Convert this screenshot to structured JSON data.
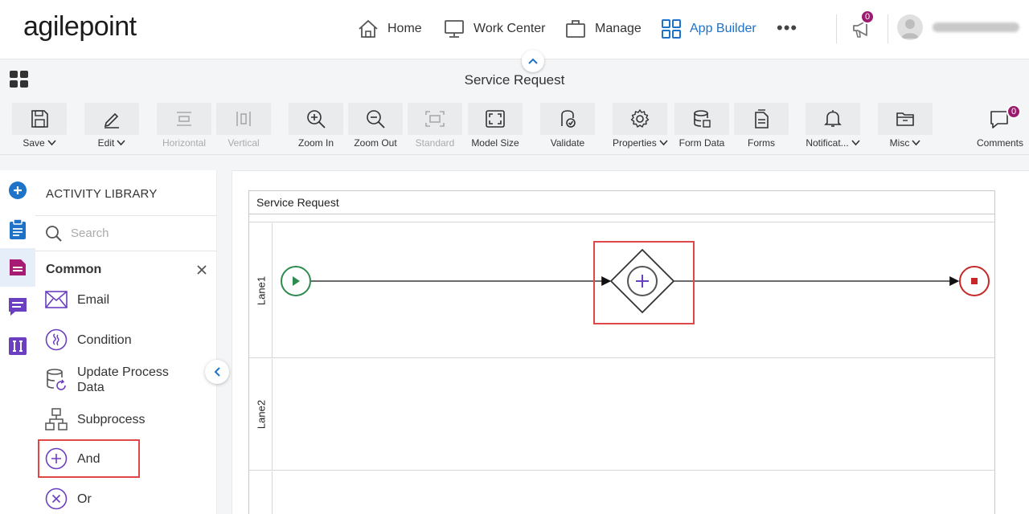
{
  "brand": {
    "logo_text": "agilepoint"
  },
  "nav": {
    "items": [
      {
        "label": "Home",
        "icon": "home-icon"
      },
      {
        "label": "Work Center",
        "icon": "monitor-icon"
      },
      {
        "label": "Manage",
        "icon": "briefcase-icon"
      },
      {
        "label": "App Builder",
        "icon": "grid-icon",
        "active": true
      }
    ],
    "notifications_count": "0"
  },
  "page": {
    "title": "Service Request"
  },
  "toolbar": {
    "save": "Save",
    "edit": "Edit",
    "horizontal": "Horizontal",
    "vertical": "Vertical",
    "zoom_in": "Zoom In",
    "zoom_out": "Zoom Out",
    "standard": "Standard",
    "model_size": "Model Size",
    "validate": "Validate",
    "properties": "Properties",
    "form_data": "Form Data",
    "forms": "Forms",
    "notifications": "Notificat...",
    "misc": "Misc",
    "comments": "Comments",
    "comments_count": "0"
  },
  "library": {
    "title": "ACTIVITY LIBRARY",
    "search_placeholder": "Search",
    "group": "Common",
    "items": {
      "email": "Email",
      "condition": "Condition",
      "update_process_data": "Update Process Data",
      "subprocess": "Subprocess",
      "and": "And",
      "or": "Or"
    }
  },
  "canvas": {
    "pool_title": "Service Request",
    "lanes": [
      "Lane1",
      "Lane2"
    ]
  },
  "colors": {
    "accent_blue": "#1e73c8",
    "badge": "#9b1b6e",
    "start_event": "#2e8b4e",
    "end_event": "#c62828",
    "highlight": "#e04848",
    "gateway_plus": "#6a3fc0"
  }
}
